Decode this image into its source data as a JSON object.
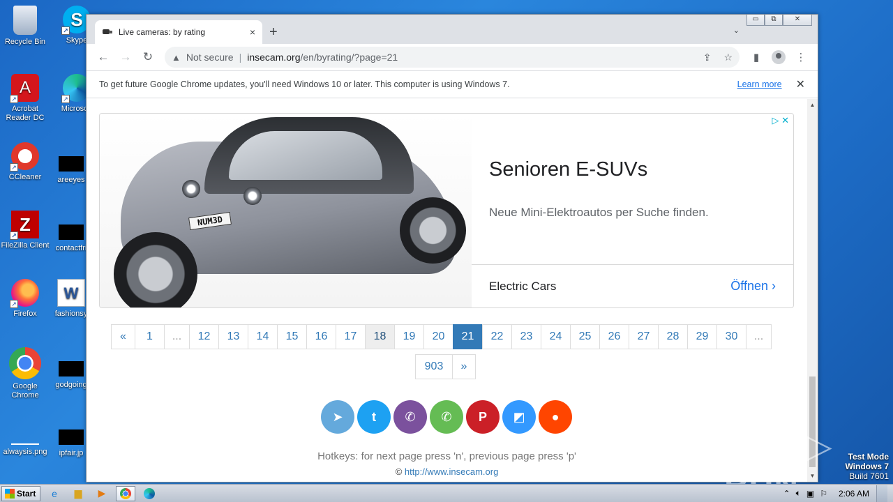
{
  "desktop": {
    "icons": [
      {
        "label": "Recycle Bin"
      },
      {
        "label": "Skype"
      },
      {
        "label": "Acrobat Reader DC"
      },
      {
        "label": "Microsoft"
      },
      {
        "label": "CCleaner"
      },
      {
        "label": "areeyes"
      },
      {
        "label": "FileZilla Client"
      },
      {
        "label": "contactfri"
      },
      {
        "label": "Firefox"
      },
      {
        "label": "fashionsy"
      },
      {
        "label": "Google Chrome"
      },
      {
        "label": "godgoing"
      },
      {
        "label": "alwaysis.png"
      },
      {
        "label": "ipfair.jp"
      }
    ]
  },
  "browser": {
    "tab_title": "Live cameras: by rating",
    "tab_close": "×",
    "new_tab": "+",
    "tab_search": "⌄",
    "window_controls": {
      "minimize": "▭",
      "restore": "⧉",
      "close": "✕"
    },
    "back": "←",
    "forward": "→",
    "reload": "↻",
    "security_label": "Not secure",
    "url_host": "insecam.org",
    "url_path": "/en/byrating/?page=21",
    "share_icon": "⇪",
    "star_icon": "☆",
    "sidepanel_icon": "▮",
    "menu_icon": "⋮",
    "infobar_message": "To get future Google Chrome updates, you'll need Windows 10 or later. This computer is using Windows 7.",
    "infobar_link": "Learn more",
    "infobar_close": "✕"
  },
  "ad": {
    "plate": "NUM3D",
    "choices": "▷ ✕",
    "headline": "Senioren E-SUVs",
    "description": "Neue Mini-Elektroautos per Suche finden.",
    "brand": "Electric Cars",
    "cta": "Öffnen ›"
  },
  "pagination": {
    "row1": [
      "«",
      "1",
      "...",
      "12",
      "13",
      "14",
      "15",
      "16",
      "17",
      "18",
      "19",
      "20",
      "21",
      "22",
      "23",
      "24",
      "25",
      "26",
      "27",
      "28",
      "29",
      "30",
      "..."
    ],
    "row2": [
      "903",
      "»"
    ],
    "active": "21",
    "hovered": "18"
  },
  "share": {
    "buttons": [
      {
        "name": "telegram",
        "glyph": "➤",
        "color": "#64a9dc"
      },
      {
        "name": "twitter",
        "glyph": "t",
        "color": "#1da1f2"
      },
      {
        "name": "viber",
        "glyph": "✆",
        "color": "#7b519d"
      },
      {
        "name": "whatsapp",
        "glyph": "✆",
        "color": "#65bc54"
      },
      {
        "name": "pinterest",
        "glyph": "P",
        "color": "#cb2027"
      },
      {
        "name": "delicious",
        "glyph": "◩",
        "color": "#3399ff"
      },
      {
        "name": "reddit",
        "glyph": "●",
        "color": "#ff4500"
      }
    ]
  },
  "page": {
    "hotkeys": "Hotkeys: for next page press 'n', previous page press 'p'",
    "copyright": "©",
    "site_link": "http://www.insecam.org"
  },
  "watermark": "ANY ▷ RUN",
  "testmode": {
    "line1": "Test Mode",
    "line2": "Windows 7",
    "line3": "Build 7601"
  },
  "taskbar": {
    "start_label": "Start",
    "clock": "2:06 AM",
    "tray_arrow": "⌃"
  }
}
